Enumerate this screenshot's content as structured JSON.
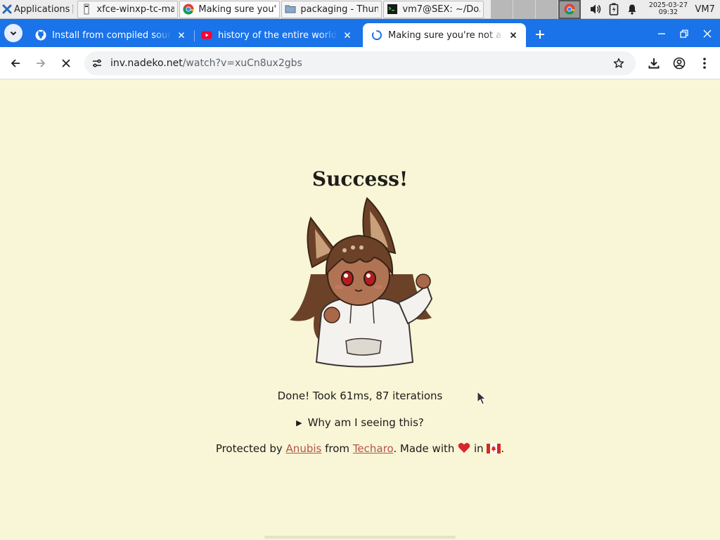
{
  "panel": {
    "apps_label": "Applications",
    "tasks": [
      {
        "label": "xfce-winxp-tc-ma...",
        "icon": "terminal-file-icon"
      },
      {
        "label": "Making sure you'...",
        "icon": "chrome-icon"
      },
      {
        "label": "packaging - Thunar",
        "icon": "folder-icon"
      },
      {
        "label": "vm7@SEX: ~/Do...",
        "icon": "terminal-icon"
      }
    ],
    "clock_date": "2025-03-27",
    "clock_time": "09:32",
    "host": "VM7"
  },
  "tabs": [
    {
      "title": "Install from compiled sour",
      "icon": "github-icon"
    },
    {
      "title": "history of the entire world,",
      "icon": "youtube-icon"
    },
    {
      "title": "Making sure you're not a bo",
      "icon": "loading-spinner-icon",
      "active": true
    }
  ],
  "toolbar": {
    "url_host": "inv.nadeko.net",
    "url_path": "/watch?v=xuCn8ux2gbs"
  },
  "page": {
    "title": "Success!",
    "status": "Done! Took 61ms, 87 iterations",
    "details_summary": "Why am I seeing this?",
    "footer_protected": "Protected by",
    "footer_anubis": "Anubis",
    "footer_from": "from",
    "footer_techaro": "Techaro",
    "footer_made": ". Made with",
    "footer_in": "in",
    "footer_end": "."
  },
  "colors": {
    "page_bg": "#f9f5d7",
    "tab_strip": "#1a73e8",
    "link": "#b2574b"
  }
}
